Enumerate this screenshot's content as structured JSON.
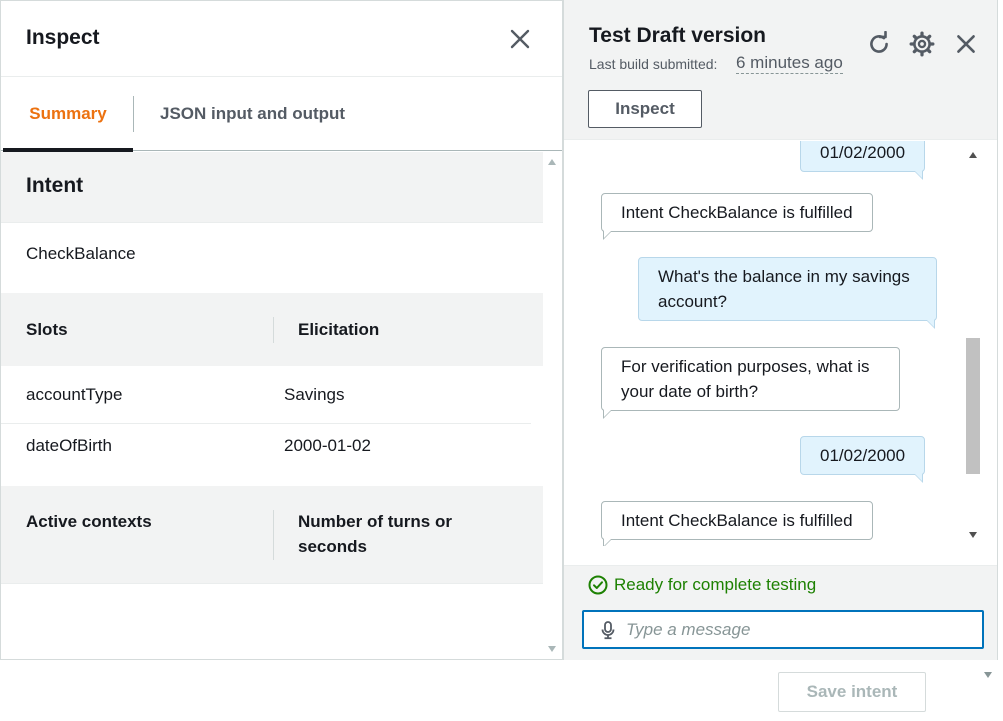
{
  "inspect": {
    "title": "Inspect",
    "tabs": [
      {
        "label": "Summary",
        "active": true
      },
      {
        "label": "JSON input and output",
        "active": false
      }
    ],
    "intent_heading": "Intent",
    "intent_name": "CheckBalance",
    "slots": {
      "col_slots": "Slots",
      "col_elicitation": "Elicitation",
      "rows": [
        {
          "name": "accountType",
          "value": "Savings"
        },
        {
          "name": "dateOfBirth",
          "value": "2000-01-02"
        }
      ]
    },
    "contexts": {
      "col_active": "Active contexts",
      "col_turns": "Number of turns or seconds"
    }
  },
  "test": {
    "title": "Test Draft version",
    "build_label": "Last build submitted:",
    "build_time": "6 minutes ago",
    "inspect_button": "Inspect",
    "messages": [
      {
        "from": "user",
        "text": "01/02/2000"
      },
      {
        "from": "bot",
        "text": "Intent CheckBalance is fulfilled"
      },
      {
        "from": "user",
        "text": "What's the balance in my savings account?"
      },
      {
        "from": "bot",
        "text": "For verification purposes, what is your date of birth?"
      },
      {
        "from": "user",
        "text": "01/02/2000"
      },
      {
        "from": "bot",
        "text": "Intent CheckBalance is fulfilled"
      }
    ],
    "status": "Ready for complete testing",
    "input_placeholder": "Type a message",
    "icons": {
      "refresh": "refresh-icon",
      "settings": "gear-icon",
      "close": "close-icon",
      "mic": "microphone-icon",
      "status": "check-circle-icon"
    }
  },
  "footer": {
    "save_button": "Save intent"
  },
  "colors": {
    "accent_orange": "#ec7211",
    "link_blue": "#0073bb",
    "success_green": "#1d8102",
    "user_bubble": "#e1f3fd"
  }
}
